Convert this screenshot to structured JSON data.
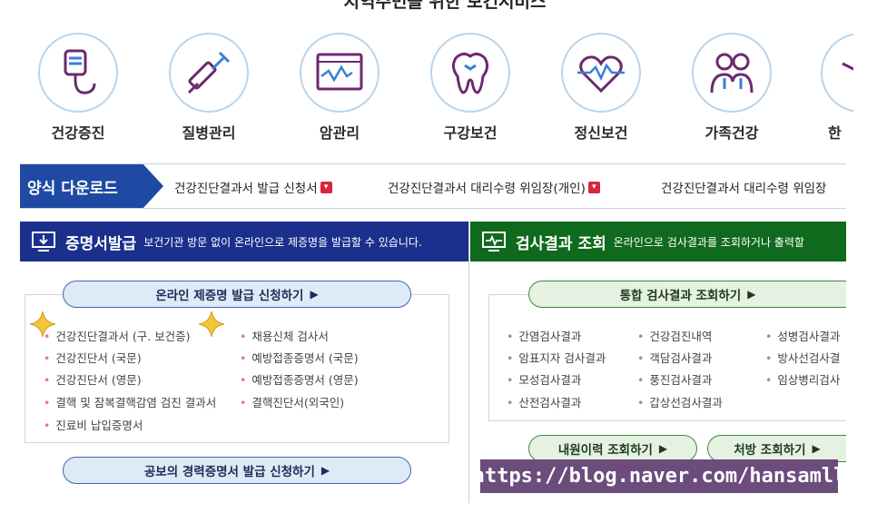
{
  "top_title": "지역주민을 위한 보건서비스",
  "services": [
    {
      "label": "건강증진",
      "icon": "iv-drip-icon"
    },
    {
      "label": "질병관리",
      "icon": "syringe-icon"
    },
    {
      "label": "암관리",
      "icon": "monitor-chart-icon"
    },
    {
      "label": "구강보건",
      "icon": "tooth-icon"
    },
    {
      "label": "정신보건",
      "icon": "heart-pulse-icon"
    },
    {
      "label": "가족건강",
      "icon": "family-icon"
    },
    {
      "label": "한",
      "icon": "partial-icon"
    }
  ],
  "download": {
    "label": "양식 다운로드",
    "items": [
      "건강진단결과서 발급 신청서",
      "건강진단결과서 대리수령 위임장(개인)",
      "건강진단결과서 대리수령 위임장"
    ]
  },
  "cert": {
    "title": "증명서발급",
    "desc": "보건기관 방문 없이 온라인으로 제증명을 발급할 수 있습니다.",
    "apply_button": "온라인 제증명 발급 신청하기",
    "items_left": [
      "건강진단결과서 (구. 보건증)",
      "건강진단서 (국문)",
      "건강진단서 (영문)",
      "결핵 및 잠복결핵감염 검진 결과서",
      "진료비 납입증명서"
    ],
    "items_right": [
      "채용신체 검사서",
      "예방접종증명서 (국문)",
      "예방접종증명서 (영문)",
      "결핵진단서(외국인)"
    ],
    "career_button": "공보의 경력증명서 발급 신청하기"
  },
  "results": {
    "title": "검사결과 조회",
    "desc": "온라인으로 검사결과를 조회하거나 출력할",
    "integrated_button": "통합 검사결과 조회하기",
    "col1": [
      "간염검사결과",
      "암표지자 검사결과",
      "모성검사결과",
      "산전검사결과"
    ],
    "col2": [
      "건강검진내역",
      "객담검사결과",
      "풍진검사결과",
      "갑상선검사결과"
    ],
    "col3": [
      "성병검사결과",
      "방사선검사결",
      "임상병리검사"
    ],
    "visit_button": "내원이력 조회하기",
    "rx_button": "처방 조회하기"
  },
  "watermark": "https://blog.naver.com/hansamll",
  "colors": {
    "cert_header": "#1b2f8c",
    "results_header": "#0f6a1e",
    "download_badge": "#1f4aa3",
    "watermark_bg": "#6b4c7c"
  }
}
